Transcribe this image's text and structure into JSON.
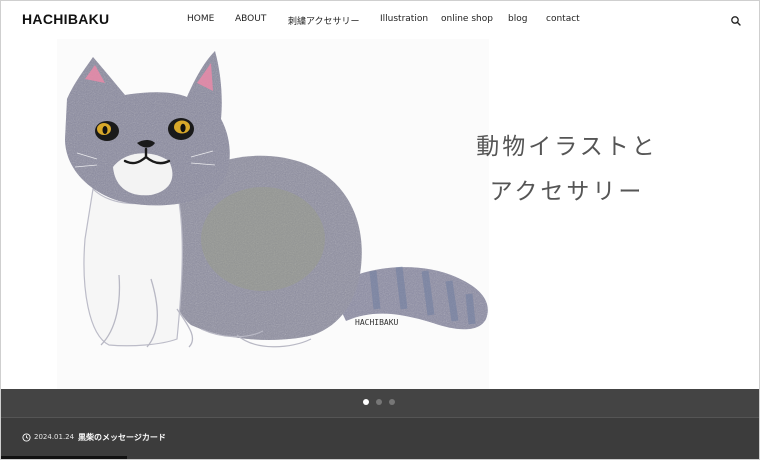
{
  "header": {
    "logo": "HACHIBAKU",
    "nav": [
      {
        "label": "HOME",
        "name": "nav-home"
      },
      {
        "label": "ABOUT",
        "name": "nav-about"
      },
      {
        "label": "刺繍アクセサリー",
        "name": "nav-embroidery-accessories"
      },
      {
        "label": "Illustration",
        "name": "nav-illustration"
      },
      {
        "label": "online shop",
        "name": "nav-online-shop"
      },
      {
        "label": "blog",
        "name": "nav-blog"
      },
      {
        "label": "contact",
        "name": "nav-contact"
      }
    ],
    "search_icon": "search-icon"
  },
  "hero": {
    "title_line1": "動物イラストと",
    "title_line2": "アクセサリー",
    "signature": "HACHIBAKU",
    "slides_total": 3,
    "active_slide": 0
  },
  "news": {
    "date": "2024.01.24",
    "title": "黒柴のメッセージカード",
    "icon": "clock-icon"
  },
  "colors": {
    "band_dark": "#3c3c3c",
    "cat_grey": "#8d8da0",
    "text_dark": "#222222"
  }
}
